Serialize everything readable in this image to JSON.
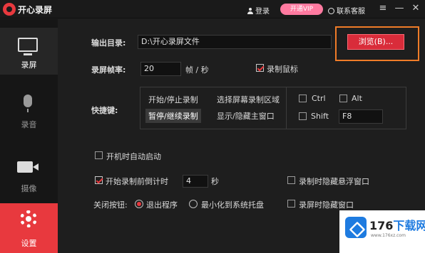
{
  "titlebar": {
    "app_name": "开心录屏",
    "login": "登录",
    "vip": "开通VIP",
    "service": "联系客服",
    "menu_glyph": "≡",
    "min_glyph": "—",
    "close_glyph": "✕"
  },
  "sidebar": {
    "items": [
      {
        "label": "录屏",
        "icon": "monitor-icon"
      },
      {
        "label": "录音",
        "icon": "mic-icon"
      },
      {
        "label": "摄像",
        "icon": "camera-icon"
      },
      {
        "label": "设置",
        "icon": "gear-icon"
      }
    ]
  },
  "settings": {
    "output_dir_label": "输出目录:",
    "output_dir_value": "D:\\开心录屏文件",
    "browse_label": "浏览(B)...",
    "fps_label": "录屏帧率:",
    "fps_value": "20",
    "fps_unit": "帧 / 秒",
    "record_mouse_label": "录制鼠标",
    "record_mouse_checked": true,
    "hotkey_label": "快捷键:",
    "hotkey_options": [
      "开始/停止录制",
      "选择屏幕录制区域",
      "暂停/继续录制",
      "显示/隐藏主窗口"
    ],
    "hotkey_selected_index": 2,
    "ctrl_label": "Ctrl",
    "alt_label": "Alt",
    "shift_label": "Shift",
    "key_value": "F8",
    "autostart_label": "开机时自动启动",
    "countdown_label": "开始录制前倒计时",
    "countdown_value": "4",
    "countdown_unit": "秒",
    "hide_float_label": "录制时隐藏悬浮窗口",
    "close_button_label": "关闭按钮:",
    "close_option_exit": "退出程序",
    "close_option_tray": "最小化到系统托盘",
    "hide_main_label": "录屏时隐藏窗口"
  },
  "watermark": {
    "num": "176",
    "text": "下载网",
    "url": "www.176xz.com"
  },
  "colors": {
    "accent": "#e8393e",
    "vip": "#ff7aa0",
    "highlight": "#f07c28"
  }
}
